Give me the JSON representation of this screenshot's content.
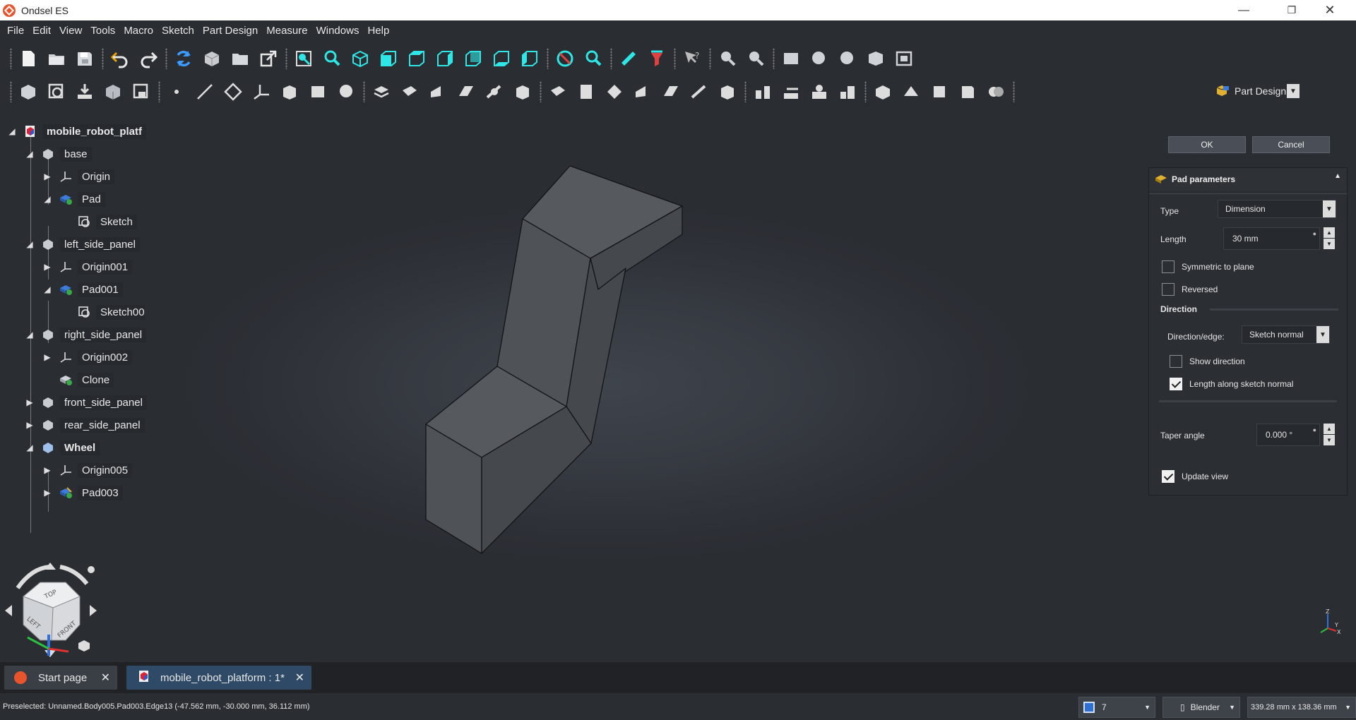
{
  "app": {
    "title": "Ondsel ES"
  },
  "menu": [
    "File",
    "Edit",
    "View",
    "Tools",
    "Macro",
    "Sketch",
    "Part Design",
    "Measure",
    "Windows",
    "Help"
  ],
  "toolbar": {
    "workbench": "Part Design"
  },
  "tree": {
    "items": [
      {
        "label": "mobile_robot_platf",
        "bold": true
      },
      {
        "label": "base"
      },
      {
        "label": "Origin"
      },
      {
        "label": "Pad"
      },
      {
        "label": "Sketch"
      },
      {
        "label": "left_side_panel"
      },
      {
        "label": "Origin001"
      },
      {
        "label": "Pad001"
      },
      {
        "label": "Sketch00"
      },
      {
        "label": "right_side_panel"
      },
      {
        "label": "Origin002"
      },
      {
        "label": "Clone"
      },
      {
        "label": "front_side_panel"
      },
      {
        "label": "rear_side_panel"
      },
      {
        "label": "Wheel",
        "bold": true
      },
      {
        "label": "Origin005"
      },
      {
        "label": "Pad003"
      }
    ]
  },
  "task": {
    "ok": "OK",
    "cancel": "Cancel",
    "panel_title": "Pad parameters",
    "type_label": "Type",
    "type_value": "Dimension",
    "length_label": "Length",
    "length_value": "30 mm",
    "symmetric_label": "Symmetric to plane",
    "symmetric_checked": false,
    "reversed_label": "Reversed",
    "reversed_checked": false,
    "direction_label": "Direction",
    "direction_edge_label": "Direction/edge:",
    "direction_edge_value": "Sketch normal",
    "show_direction_label": "Show direction",
    "show_direction_checked": false,
    "length_along_label": "Length along sketch normal",
    "length_along_checked": true,
    "taper_label": "Taper angle",
    "taper_value": "0.000 °",
    "update_view_label": "Update view",
    "update_view_checked": true
  },
  "navcube": {
    "top": "TOP",
    "left": "LEFT",
    "front": "FRONT"
  },
  "axis": {
    "z": "Z",
    "y": "Y",
    "x": "X"
  },
  "tabs": [
    {
      "label": "Start page",
      "active": false
    },
    {
      "label": "mobile_robot_platform : 1*",
      "active": true
    }
  ],
  "status": {
    "message": "Preselected: Unnamed.Body005.Pad003.Edge13 (-47.562 mm, -30.000 mm, 36.112 mm)",
    "draw_style": "7",
    "nav_style": "Blender",
    "dimensions": "339.28 mm x 138.36 mm"
  },
  "colors": {
    "accent": "#2ee6e6",
    "brand": "#e8542b",
    "background": "#2b2e33",
    "active_tab": "#2e4a66"
  }
}
